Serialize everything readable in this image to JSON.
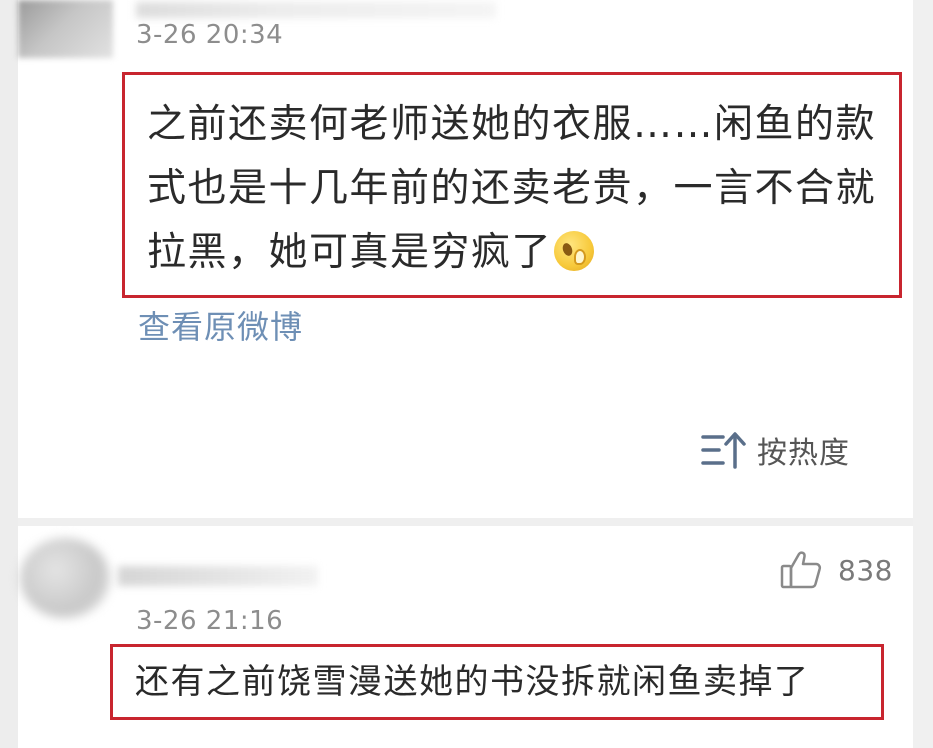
{
  "top_post": {
    "timestamp": "3-26 20:34",
    "content": "之前还卖何老师送她的衣服……闲鱼的款式也是十几年前的还卖老贵，一言不合就拉黑，她可真是穷疯了",
    "emoji": "face-emoji",
    "view_original_label": "查看原微博",
    "sort_label": "按热度",
    "sort_icon": "sort-up-icon",
    "highlight_color": "#c8252f"
  },
  "bottom_comment": {
    "timestamp": "3-26 21:16",
    "like_icon": "thumbs-up-icon",
    "like_count": "838",
    "content": "还有之前饶雪漫送她的书没拆就闲鱼卖掉了",
    "highlight_color": "#c8252f"
  },
  "colors": {
    "link": "#6e8fb5",
    "timestamp": "#8d8d8d",
    "text": "#2a2a2a"
  }
}
